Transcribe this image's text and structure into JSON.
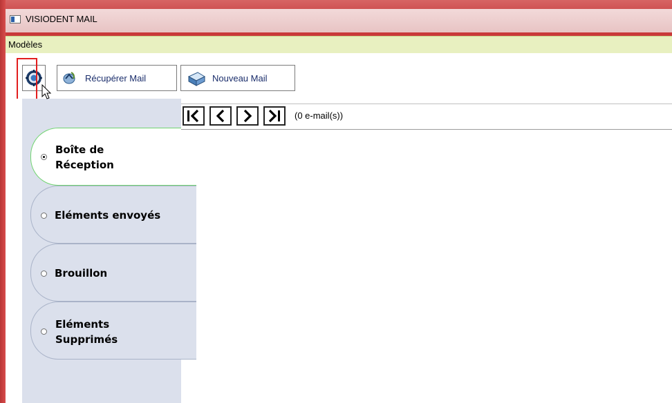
{
  "window": {
    "title": "VISIODENT MAIL",
    "accent": "#c43f40"
  },
  "menu": {
    "items": [
      "Modèles"
    ]
  },
  "toolbar": {
    "settings_icon": "gear-icon",
    "recuperer_label": "Récupérer Mail",
    "nouveau_label": "Nouveau Mail"
  },
  "navigation": {
    "buttons": [
      "first",
      "previous",
      "next",
      "last"
    ],
    "count_text": "(0 e-mail(s))"
  },
  "folders": [
    {
      "line1": "Boîte de",
      "line2": "Réception",
      "selected": true
    },
    {
      "line1": "Eléments envoyés",
      "line2": "",
      "selected": false
    },
    {
      "line1": "Brouillon",
      "line2": "",
      "selected": false
    },
    {
      "line1": "Eléments",
      "line2": "Supprimés",
      "selected": false
    }
  ]
}
